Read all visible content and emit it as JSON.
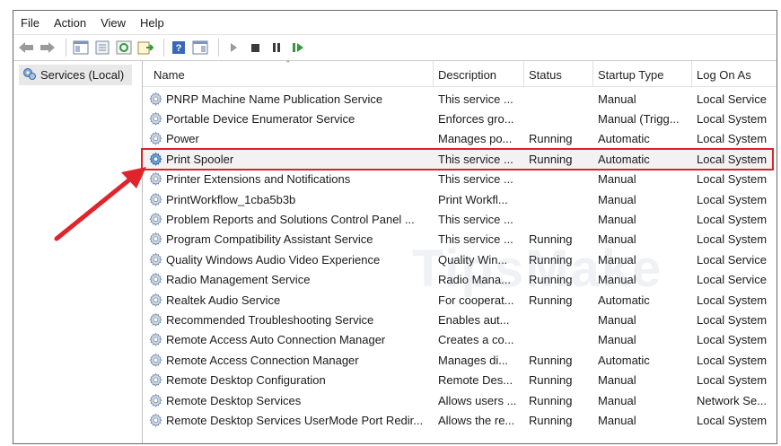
{
  "menu": [
    "File",
    "Action",
    "View",
    "Help"
  ],
  "tree": {
    "label": "Services (Local)"
  },
  "columns": {
    "name": "Name",
    "description": "Description",
    "status": "Status",
    "startup": "Startup Type",
    "logon": "Log On As"
  },
  "rows": [
    {
      "name": "PNRP Machine Name Publication Service",
      "desc": "This service ...",
      "status": "",
      "startup": "Manual",
      "logon": "Local Service"
    },
    {
      "name": "Portable Device Enumerator Service",
      "desc": "Enforces gro...",
      "status": "",
      "startup": "Manual (Trigg...",
      "logon": "Local System"
    },
    {
      "name": "Power",
      "desc": "Manages po...",
      "status": "Running",
      "startup": "Automatic",
      "logon": "Local System"
    },
    {
      "name": "Print Spooler",
      "desc": "This service ...",
      "status": "Running",
      "startup": "Automatic",
      "logon": "Local System"
    },
    {
      "name": "Printer Extensions and Notifications",
      "desc": "This service ...",
      "status": "",
      "startup": "Manual",
      "logon": "Local System"
    },
    {
      "name": "PrintWorkflow_1cba5b3b",
      "desc": "Print Workfl...",
      "status": "",
      "startup": "Manual",
      "logon": "Local System"
    },
    {
      "name": "Problem Reports and Solutions Control Panel ...",
      "desc": "This service ...",
      "status": "",
      "startup": "Manual",
      "logon": "Local System"
    },
    {
      "name": "Program Compatibility Assistant Service",
      "desc": "This service ...",
      "status": "Running",
      "startup": "Manual",
      "logon": "Local System"
    },
    {
      "name": "Quality Windows Audio Video Experience",
      "desc": "Quality Win...",
      "status": "Running",
      "startup": "Manual",
      "logon": "Local Service"
    },
    {
      "name": "Radio Management Service",
      "desc": "Radio Mana...",
      "status": "Running",
      "startup": "Manual",
      "logon": "Local Service"
    },
    {
      "name": "Realtek Audio Service",
      "desc": "For cooperat...",
      "status": "Running",
      "startup": "Automatic",
      "logon": "Local System"
    },
    {
      "name": "Recommended Troubleshooting Service",
      "desc": "Enables aut...",
      "status": "",
      "startup": "Manual",
      "logon": "Local System"
    },
    {
      "name": "Remote Access Auto Connection Manager",
      "desc": "Creates a co...",
      "status": "",
      "startup": "Manual",
      "logon": "Local System"
    },
    {
      "name": "Remote Access Connection Manager",
      "desc": "Manages di...",
      "status": "Running",
      "startup": "Automatic",
      "logon": "Local System"
    },
    {
      "name": "Remote Desktop Configuration",
      "desc": "Remote Des...",
      "status": "Running",
      "startup": "Manual",
      "logon": "Local System"
    },
    {
      "name": "Remote Desktop Services",
      "desc": "Allows users ...",
      "status": "Running",
      "startup": "Manual",
      "logon": "Network Se..."
    },
    {
      "name": "Remote Desktop Services UserMode Port Redir...",
      "desc": "Allows the re...",
      "status": "Running",
      "startup": "Manual",
      "logon": "Local System"
    }
  ],
  "highlighted_row": "Print Spooler",
  "watermark": "TipsMake",
  "colors": {
    "highlight_border": "#d9232a",
    "arrow": "#e0242a",
    "gear": "#4a8fd4"
  }
}
